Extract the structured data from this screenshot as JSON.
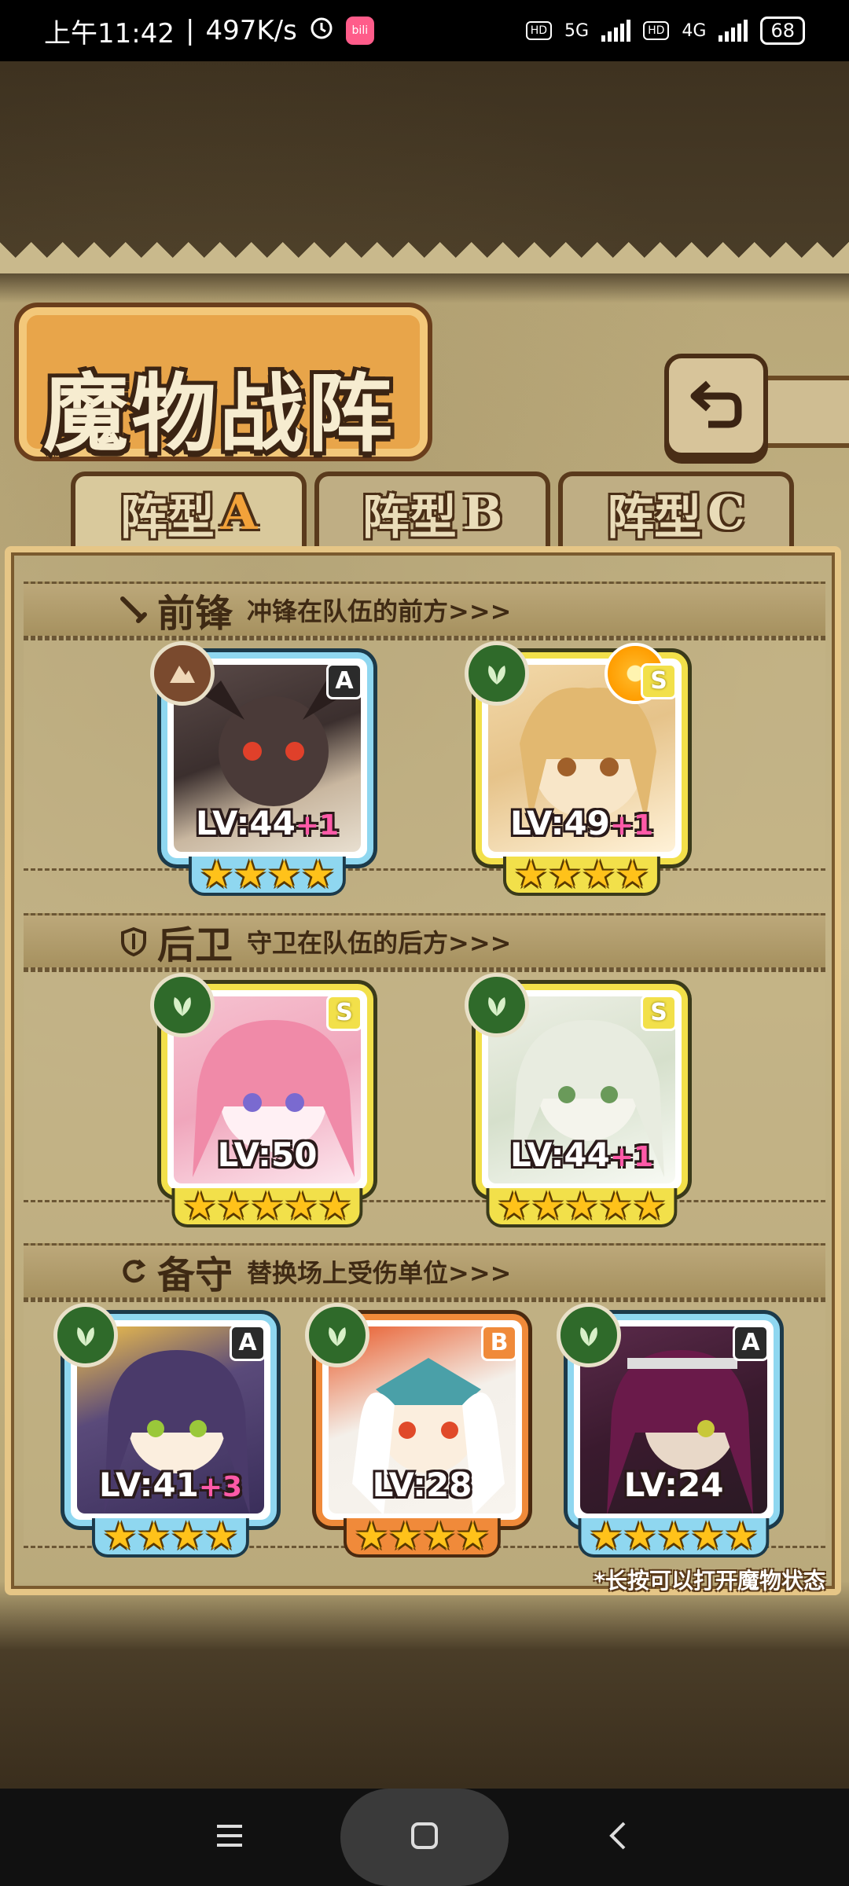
{
  "status_bar": {
    "time": "上午11:42",
    "speed": "497K/s",
    "hd1": "HD",
    "net1": "5G",
    "hd2": "HD",
    "net2": "4G",
    "battery": "68"
  },
  "header": {
    "title": "魔物战阵",
    "back_icon": "return-arrow-icon"
  },
  "tabs": [
    {
      "prefix": "阵型",
      "letter": "A",
      "active": true
    },
    {
      "prefix": "阵型",
      "letter": "B",
      "active": false
    },
    {
      "prefix": "阵型",
      "letter": "C",
      "active": false
    }
  ],
  "sections": {
    "vanguard": {
      "name": "前锋",
      "desc": "冲锋在队伍的前方>>>",
      "icon": "sword-icon"
    },
    "rear": {
      "name": "后卫",
      "desc": "守卫在队伍的后方>>>",
      "icon": "shield-icon"
    },
    "reserve": {
      "name": "备守",
      "desc": "替换场上受伤单位>>>",
      "icon": "swap-icon"
    }
  },
  "cards": {
    "v1": {
      "grade": "A",
      "level": "LV:44",
      "plus": "+1",
      "stars": "★★★★",
      "element": "earth-icon"
    },
    "v2": {
      "grade": "S",
      "level": "LV:49",
      "plus": "+1",
      "stars": "★★★★",
      "element": "leaf-icon"
    },
    "r1": {
      "grade": "S",
      "level": "LV:50",
      "plus": "",
      "stars": "★★★★★",
      "element": "leaf-icon"
    },
    "r2": {
      "grade": "S",
      "level": "LV:44",
      "plus": "+1",
      "stars": "★★★★★",
      "element": "leaf-icon"
    },
    "b1": {
      "grade": "A",
      "level": "LV:41",
      "plus": "+3",
      "stars": "★★★★",
      "element": "leaf-icon"
    },
    "b2": {
      "grade": "B",
      "level": "LV:28",
      "plus": "",
      "stars": "★★★★",
      "element": "leaf-icon"
    },
    "b3": {
      "grade": "A",
      "level": "LV:24",
      "plus": "",
      "stars": "★★★★★",
      "element": "leaf-icon"
    }
  },
  "hint": "*长按可以打开魔物状态",
  "nav": {
    "menu_icon": "menu-icon",
    "home_icon": "home-icon",
    "back_icon": "back-chevron-icon"
  }
}
